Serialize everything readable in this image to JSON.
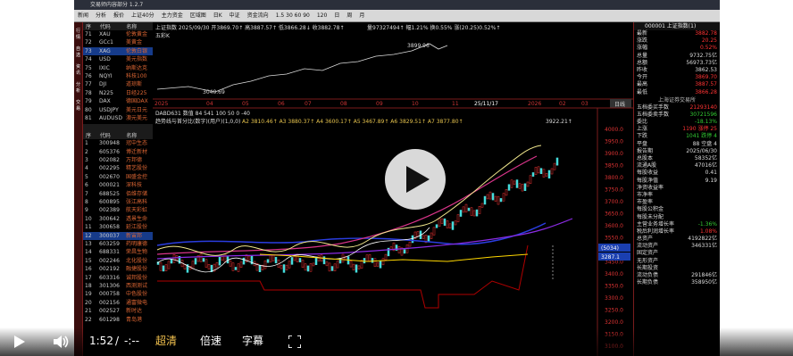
{
  "app": {
    "title": "交易师内容部分 1.2.7"
  },
  "toolbar": {
    "items": [
      "新闻",
      "分析",
      "报价",
      "上证40分",
      "主力资金",
      "区域图",
      "日K",
      "中证",
      "资金流向",
      "1.5 30 60 90",
      "120",
      "日",
      "周",
      "月"
    ]
  },
  "sidebar": {
    "labels": [
      "行情",
      "自选",
      "资讯",
      "分析",
      "交易"
    ]
  },
  "quote_list_top": {
    "headers": [
      "序",
      "代码",
      "名称"
    ],
    "rows": [
      {
        "n": "71",
        "code": "XAU",
        "name": "伦敦黄金"
      },
      {
        "n": "72",
        "code": "GCc1",
        "name": "美黄金"
      },
      {
        "n": "73",
        "code": "XAG",
        "name": "伦敦白银"
      },
      {
        "n": "74",
        "code": "USD",
        "name": "美元指数"
      },
      {
        "n": "75",
        "code": "IXIC",
        "name": "纳斯达克"
      },
      {
        "n": "76",
        "code": "NQYI",
        "name": "科技100"
      },
      {
        "n": "77",
        "code": "DJI",
        "name": "道琼斯"
      },
      {
        "n": "78",
        "code": "N225",
        "name": "日经225"
      },
      {
        "n": "79",
        "code": "DAX",
        "name": "德国DAX"
      },
      {
        "n": "80",
        "code": "USDJPY",
        "name": "美元日元"
      },
      {
        "n": "81",
        "code": "AUDUSD",
        "name": "澳元美元"
      }
    ]
  },
  "quote_list_bottom": {
    "headers": [
      "序",
      "代码",
      "名称"
    ],
    "rows": [
      {
        "n": "1",
        "code": "300948",
        "name": "冠中生态"
      },
      {
        "n": "2",
        "code": "605376",
        "name": "博迁新材"
      },
      {
        "n": "3",
        "code": "002082",
        "name": "万邦德"
      },
      {
        "n": "4",
        "code": "002295",
        "name": "精艺股份"
      },
      {
        "n": "5",
        "code": "002670",
        "name": "国盛金控"
      },
      {
        "n": "6",
        "code": "000021",
        "name": "深科技"
      },
      {
        "n": "7",
        "code": "688525",
        "name": "佰维存储"
      },
      {
        "n": "8",
        "code": "600895",
        "name": "张江高科"
      },
      {
        "n": "9",
        "code": "002389",
        "name": "航天彩虹"
      },
      {
        "n": "10",
        "code": "300642",
        "name": "透景生命"
      },
      {
        "n": "11",
        "code": "300658",
        "name": "延江股份"
      },
      {
        "n": "12",
        "code": "300037",
        "name": "新宙邦"
      },
      {
        "n": "13",
        "code": "603259",
        "name": "药明康德"
      },
      {
        "n": "14",
        "code": "688331",
        "name": "荣昌生物"
      },
      {
        "n": "15",
        "code": "002246",
        "name": "北化股份"
      },
      {
        "n": "16",
        "code": "002192",
        "name": "融捷股份"
      },
      {
        "n": "17",
        "code": "603316",
        "name": "诚邦股份"
      },
      {
        "n": "18",
        "code": "301306",
        "name": "西测测试"
      },
      {
        "n": "19",
        "code": "000758",
        "name": "中色股份"
      },
      {
        "n": "20",
        "code": "002156",
        "name": "通富微电"
      },
      {
        "n": "21",
        "code": "002527",
        "name": "新时达"
      },
      {
        "n": "22",
        "code": "601298",
        "name": "青岛港"
      }
    ]
  },
  "chart_top": {
    "header": "上证指数 2025/09/30 开3869.70↑ 高3887.57↑ 低3866.28↓ 收3882.78↑",
    "volume_text": "量97327494↑ 幅1.21% 换0.55% 涨(20.25)0.52%↑",
    "sub": "五彩K",
    "high_label": "3899.96",
    "low_label": "3040.69",
    "x_labels": [
      "2025",
      "04",
      "05",
      "06",
      "07",
      "08",
      "09",
      "10",
      "11",
      "25/11/17",
      "2026",
      "02",
      "03"
    ],
    "right_btn": "日线"
  },
  "chart_mid": {
    "header": "趋势线与首分比(数字)(用户)(1,0,0)",
    "params": "DABD631 数值 84 541 100 50 0 -40",
    "a_values": "A2 3810.46↑ A3 3880.37↑ A4 3600.17↑ A5 3467.89↑ A6 3829.51↑ A7 3877.80↑",
    "last_price": "3922.21↑",
    "y_labels": [
      "4000.0",
      "3950.0",
      "3900.0",
      "3850.0",
      "3800.0",
      "3750.0",
      "3700.0",
      "3650.0",
      "3600.0",
      "3550.0",
      "3500.0",
      "3450.0",
      "3400.0",
      "3350.0",
      "3300.0",
      "3250.0",
      "3200.0",
      "3150.0",
      "3100.0"
    ],
    "tag1": "(5034)",
    "tag2": "3287.1"
  },
  "right_panel": {
    "title": "000001 上证指数(1)",
    "rows": [
      {
        "k": "最新",
        "v": "3882.78",
        "c": "r"
      },
      {
        "k": "涨跌",
        "v": "20.25",
        "c": "r"
      },
      {
        "k": "涨幅",
        "v": "0.52%",
        "c": "r"
      },
      {
        "k": "总量",
        "v": "9732.75亿",
        "c": "v"
      },
      {
        "k": "总额",
        "v": "56973.73亿",
        "c": "v"
      },
      {
        "k": "昨收",
        "v": "3862.53",
        "c": "v"
      },
      {
        "k": "今开",
        "v": "3869.70",
        "c": "r"
      },
      {
        "k": "最高",
        "v": "3887.57",
        "c": "r"
      },
      {
        "k": "最低",
        "v": "3866.28",
        "c": "r"
      }
    ],
    "exchange": "上海证券交易所",
    "rows2": [
      {
        "k": "五档委买手数",
        "v": "21293140",
        "c": "r"
      },
      {
        "k": "五档委卖手数",
        "v": "30721596",
        "c": "g"
      },
      {
        "k": "委比",
        "v": "-18.13%",
        "c": "g"
      },
      {
        "k": "上涨",
        "v": "1190 涨停 25",
        "c": "r"
      },
      {
        "k": "下跌",
        "v": "1041 跌停 4",
        "c": "g"
      },
      {
        "k": "平盘",
        "v": "88 空盘 4",
        "c": "v"
      },
      {
        "k": "报告期",
        "v": "2025/06/30",
        "c": "v"
      },
      {
        "k": "总股本",
        "v": "58352亿",
        "c": "v"
      },
      {
        "k": "流通A股",
        "v": "47016亿",
        "c": "v"
      },
      {
        "k": "每股收益",
        "v": "0.41",
        "c": "v"
      },
      {
        "k": "每股净值",
        "v": "9.19",
        "c": "v"
      },
      {
        "k": "净资收益率",
        "v": "",
        "c": "v"
      },
      {
        "k": "市净率",
        "v": "",
        "c": "v"
      },
      {
        "k": "市盈率",
        "v": "",
        "c": "v"
      },
      {
        "k": "每股公积金",
        "v": "",
        "c": "v"
      },
      {
        "k": "每股未分配",
        "v": "",
        "c": "v"
      },
      {
        "k": "主营业务增长率",
        "v": "-1.36%",
        "c": "g"
      },
      {
        "k": "税后利润增长率",
        "v": "1.08%",
        "c": "r"
      },
      {
        "k": "总资产",
        "v": "4192822亿",
        "c": "v"
      },
      {
        "k": "流动资产",
        "v": "346331亿",
        "c": "v"
      },
      {
        "k": "固定资产",
        "v": "",
        "c": "v"
      },
      {
        "k": "无形资产",
        "v": "",
        "c": "v"
      },
      {
        "k": "长期投资",
        "v": "",
        "c": "v"
      },
      {
        "k": "流动负债",
        "v": "291846亿",
        "c": "v"
      },
      {
        "k": "长期负债",
        "v": "358950亿",
        "c": "v"
      }
    ]
  },
  "video_controls": {
    "time_current": "1:52",
    "time_sep": "/",
    "time_total": "-:--",
    "quality": "超清",
    "speed": "倍速",
    "subtitle": "字幕"
  },
  "colors": {
    "accent_quality": "#f2c14e",
    "up": "#ff3333",
    "down": "#33cc33"
  }
}
